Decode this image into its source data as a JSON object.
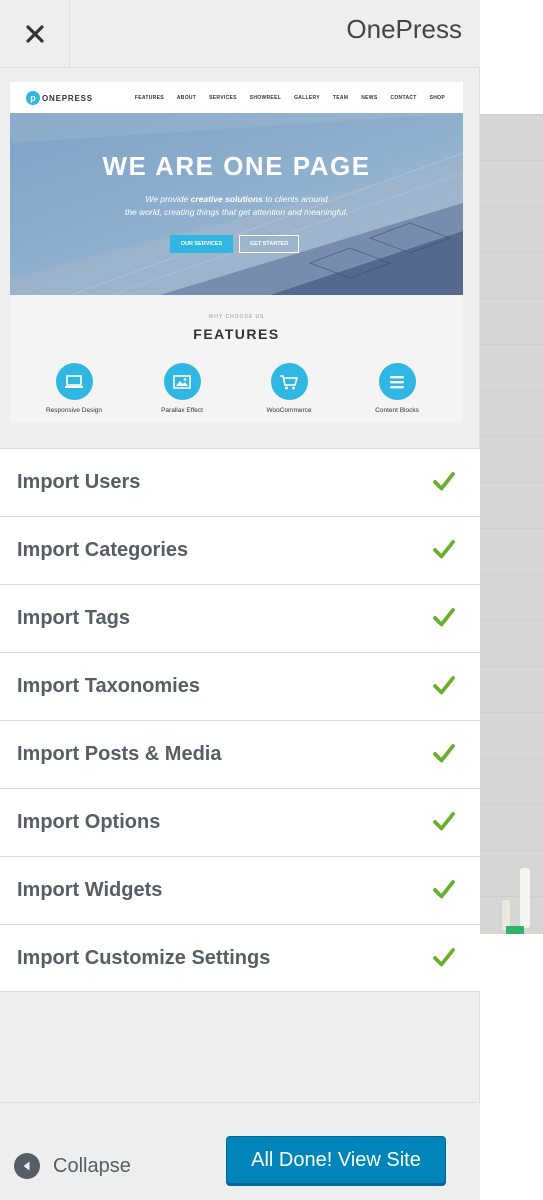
{
  "header": {
    "close_icon": "close-icon",
    "theme_name": "OnePress"
  },
  "theme_screenshot": {
    "logo_letter": "p",
    "logo_text": "ONEPRESS",
    "nav": [
      "FEATURES",
      "ABOUT",
      "SERVICES",
      "SHOWREEL",
      "GALLERY",
      "TEAM",
      "NEWS",
      "CONTACT",
      "SHOP"
    ],
    "hero_title": "WE ARE ONE PAGE",
    "hero_sub_line1_pre": "We provide ",
    "hero_sub_line1_bold": "creative solutions",
    "hero_sub_line1_post": " to clients around",
    "hero_sub_line2": "the world, creating things that get attention and meaningful.",
    "btn_services": "OUR SERVICES",
    "btn_started": "GET STARTED",
    "why": "WHY CHOOSE US",
    "features_title": "FEATURES",
    "features": [
      {
        "label": "Responsive Design",
        "icon": "laptop-icon"
      },
      {
        "label": "Parallax Effect",
        "icon": "image-icon"
      },
      {
        "label": "WooCommerce",
        "icon": "cart-icon"
      },
      {
        "label": "Content Blocks",
        "icon": "menu-icon"
      }
    ]
  },
  "imports": [
    {
      "label": "Import Users",
      "status": "done"
    },
    {
      "label": "Import Categories",
      "status": "done"
    },
    {
      "label": "Import Tags",
      "status": "done"
    },
    {
      "label": "Import Taxonomies",
      "status": "done"
    },
    {
      "label": "Import Posts & Media",
      "status": "done"
    },
    {
      "label": "Import Options",
      "status": "done"
    },
    {
      "label": "Import Widgets",
      "status": "done"
    },
    {
      "label": "Import Customize Settings",
      "status": "done"
    }
  ],
  "footer": {
    "collapse_label": "Collapse",
    "done_button": "All Done! View Site"
  },
  "colors": {
    "accent": "#2fb6e2",
    "check": "#6aaf2e",
    "primary_button": "#0085ba"
  }
}
